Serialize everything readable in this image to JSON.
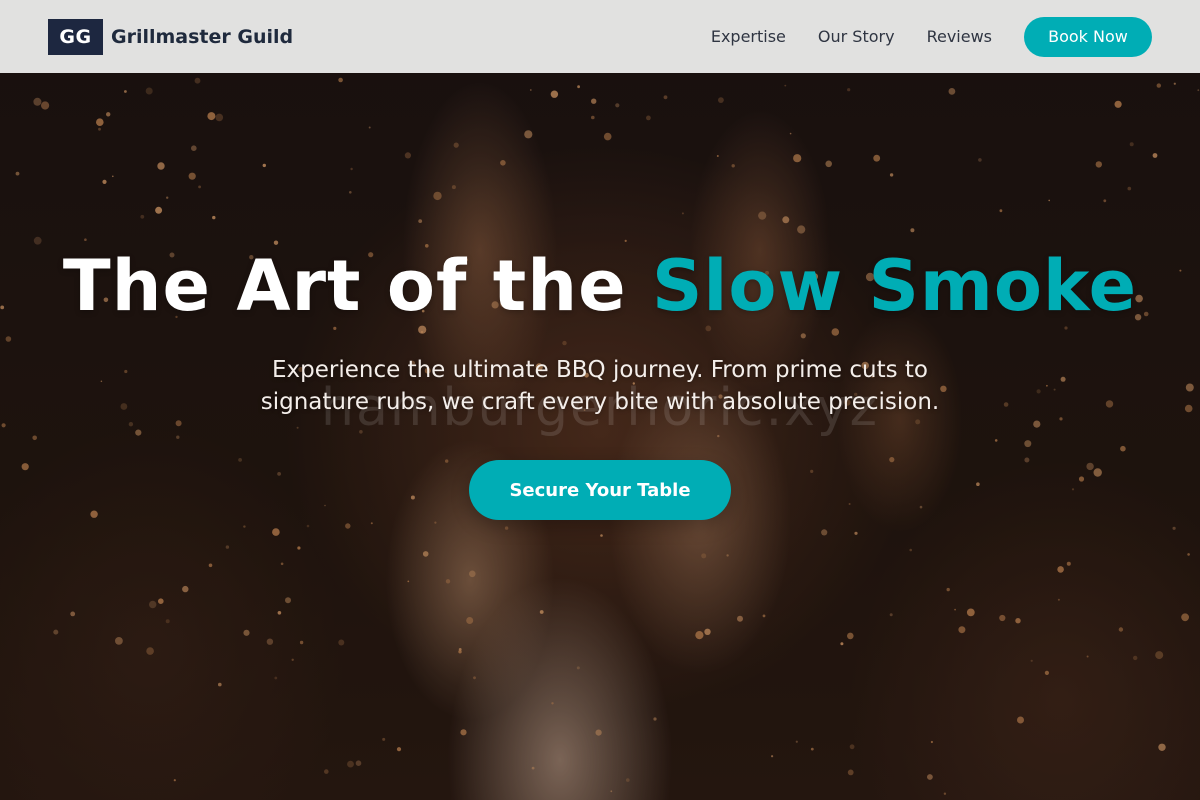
{
  "brand": {
    "badge": "GG",
    "name": "Grillmaster Guild"
  },
  "nav": {
    "links": [
      {
        "label": "Expertise"
      },
      {
        "label": "Our Story"
      },
      {
        "label": "Reviews"
      }
    ],
    "cta_label": "Book Now"
  },
  "hero": {
    "title_main": "The Art of the ",
    "title_accent": "Slow Smoke",
    "watermark": "hamburgerhoric.xyz",
    "subtitle": "Experience the ultimate BBQ journey. From prime cuts to signature rubs, we craft every bite with absolute precision.",
    "cta_label": "Secure Your Table"
  },
  "colors": {
    "accent": "#00adb5",
    "brand_dark": "#1d2740",
    "navbar_bg": "#eeeeee"
  }
}
